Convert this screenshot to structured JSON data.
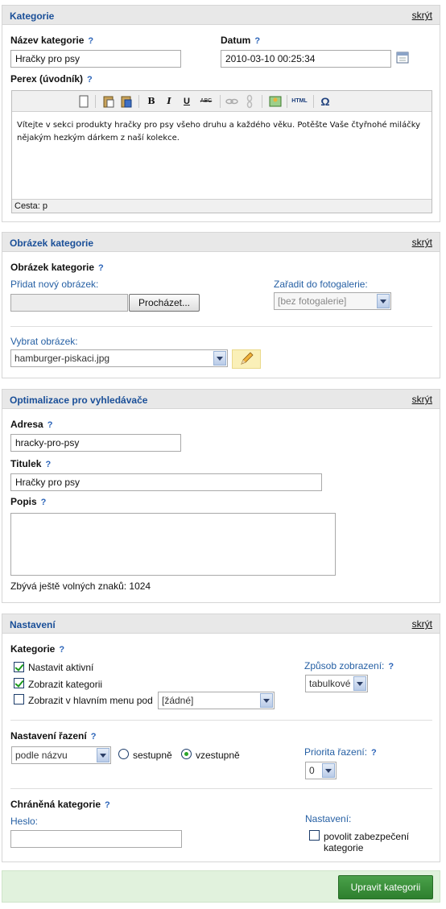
{
  "help": "?",
  "kategorie": {
    "title": "Kategorie",
    "hide": "skrýt",
    "name_label": "Název kategorie",
    "name_value": "Hračky pro psy",
    "date_label": "Datum",
    "date_value": "2010-03-10 00:25:34",
    "perex_label": "Perex (úvodník)",
    "toolbar": {
      "bold": "B",
      "italic": "I",
      "underline": "U",
      "strike": "ABC",
      "html": "HTML",
      "omega": "Ω"
    },
    "perex_text": "Vítejte v sekci produkty hračky pro psy všeho druhu a každého věku. Potěšte Vaše čtyřnohé miláčky nějakým hezkým dárkem z naší kolekce.",
    "path_label": "Cesta: p"
  },
  "obrazek": {
    "title": "Obrázek kategorie",
    "hide": "skrýt",
    "section_label": "Obrázek kategorie",
    "add_label": "Přidat nový obrázek:",
    "browse_button": "Procházet...",
    "gallery_label": "Zařadit do fotogalerie:",
    "gallery_value": "[bez fotogalerie]",
    "select_label": "Vybrat obrázek:",
    "select_value": "hamburger-piskaci.jpg"
  },
  "seo": {
    "title": "Optimalizace pro vyhledávače",
    "hide": "skrýt",
    "address_label": "Adresa",
    "address_value": "hracky-pro-psy",
    "title_label": "Titulek",
    "title_value": "Hračky pro psy",
    "desc_label": "Popis",
    "chars_left": "Zbývá ještě volných znaků: 1024"
  },
  "nastaveni": {
    "title": "Nastavení",
    "hide": "skrýt",
    "category_label": "Kategorie",
    "cb_active": "Nastavit aktivní",
    "cb_show": "Zobrazit kategorii",
    "cb_menu": "Zobrazit v hlavním menu pod",
    "menu_value": "[žádné]",
    "display_label": "Způsob zobrazení:",
    "display_value": "tabulkové",
    "sort_label": "Nastavení řazení",
    "sort_value": "podle názvu",
    "desc_radio": "sestupně",
    "asc_radio": "vzestupně",
    "priority_label": "Priorita řazení:",
    "priority_value": "0",
    "protected_label": "Chráněná kategorie",
    "password_label": "Heslo:",
    "settings_label": "Nastavení:",
    "security_cb": "povolit zabezpečení kategorie"
  },
  "submit_button": "Upravit kategorii"
}
